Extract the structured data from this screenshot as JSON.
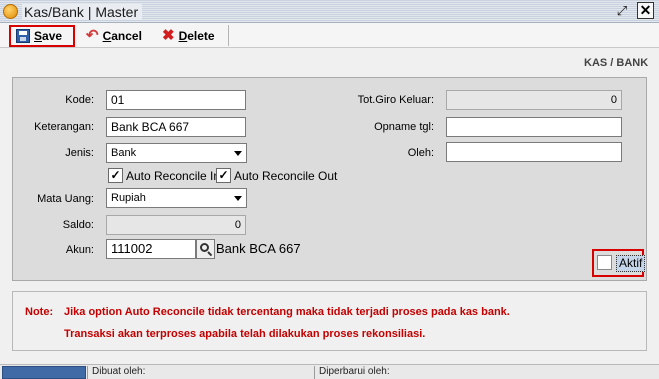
{
  "window": {
    "title": "Kas/Bank | Master"
  },
  "toolbar": {
    "save_label": "Save",
    "cancel_label": "Cancel",
    "delete_label": "Delete"
  },
  "section_title": "KAS / BANK",
  "form": {
    "kode": {
      "label": "Kode:",
      "value": "01"
    },
    "keterangan": {
      "label": "Keterangan:",
      "value": "Bank BCA 667"
    },
    "jenis": {
      "label": "Jenis:",
      "value": "Bank"
    },
    "auto_reconcile_in": {
      "label": "Auto Reconcile In",
      "checked": true,
      "mark": "✓"
    },
    "auto_reconcile_out": {
      "label": "Auto Reconcile Out",
      "checked": true,
      "mark": "✓"
    },
    "mata_uang": {
      "label": "Mata Uang:",
      "value": "Rupiah"
    },
    "saldo": {
      "label": "Saldo:",
      "value": "0"
    },
    "akun": {
      "label": "Akun:",
      "value": "111002",
      "name": "Bank BCA 667"
    },
    "tot_giro_keluar": {
      "label": "Tot.Giro Keluar:",
      "value": "0"
    },
    "opname_tgl": {
      "label": "Opname tgl:",
      "value": ""
    },
    "oleh": {
      "label": "Oleh:",
      "value": ""
    },
    "aktif": {
      "label": "Aktif",
      "checked": false
    }
  },
  "note": {
    "prefix": "Note:",
    "line1": "Jika option Auto Reconcile tidak tercentang maka tidak terjadi proses pada kas bank.",
    "line2": "Transaksi akan terproses apabila telah dilakukan proses rekonsiliasi."
  },
  "statusbar": {
    "created_by_label": "Dibuat oleh:",
    "updated_by_label": "Diperbarui oleh:"
  },
  "icons": {
    "app": "app-logo-icon",
    "save": "floppy-disk-icon",
    "cancel": "undo-arrow-icon",
    "delete": "red-x-icon",
    "lookup": "magnifier-icon"
  },
  "colors": {
    "highlight_border": "#d90000",
    "note_text": "#c40000"
  }
}
